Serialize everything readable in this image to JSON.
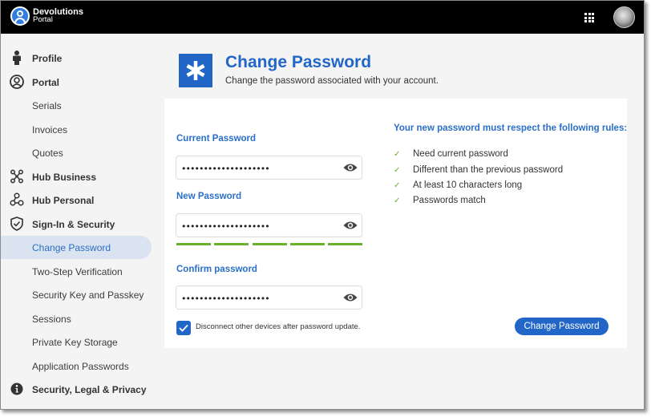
{
  "app": {
    "logo_line1": "Devolutions",
    "logo_line2": "Portal",
    "apps_icon": "grid-icon",
    "avatar": "user-avatar"
  },
  "sidebar": {
    "items": [
      {
        "label": "Profile",
        "icon": "person-icon",
        "top": true
      },
      {
        "label": "Portal",
        "icon": "user-circle-icon",
        "top": true
      },
      {
        "label": "Serials"
      },
      {
        "label": "Invoices"
      },
      {
        "label": "Quotes"
      },
      {
        "label": "Hub Business",
        "icon": "hub-business-icon",
        "top": true
      },
      {
        "label": "Hub Personal",
        "icon": "hub-personal-icon",
        "top": true
      },
      {
        "label": "Sign-In & Security",
        "icon": "shield-check-icon",
        "top": true
      },
      {
        "label": "Change Password",
        "active": true
      },
      {
        "label": "Two-Step Verification"
      },
      {
        "label": "Security Key and Passkey"
      },
      {
        "label": "Sessions"
      },
      {
        "label": "Private Key Storage"
      },
      {
        "label": "Application Passwords"
      },
      {
        "label": "Security, Legal & Privacy",
        "icon": "info-icon",
        "top": true
      }
    ]
  },
  "header": {
    "icon": "asterisk-icon",
    "icon_glyph": "*",
    "title": "Change Password",
    "subtitle": "Change the password associated with your account."
  },
  "form": {
    "current": {
      "label": "Current Password",
      "value": "••••••••••••••••••••"
    },
    "new": {
      "label": "New Password",
      "value": "••••••••••••••••••••",
      "strength_segments_filled": 5,
      "strength_segments_total": 5
    },
    "confirm": {
      "label": "Confirm password",
      "value": "••••••••••••••••••••"
    },
    "disconnect": {
      "label": "Disconnect other devices after password update.",
      "checked": true
    },
    "submit_label": "Change Password"
  },
  "rules": {
    "title": "Your new password must respect the following rules:",
    "items": [
      {
        "text": "Need current password",
        "met": true
      },
      {
        "text": "Different than the previous password",
        "met": true
      },
      {
        "text": "At least 10 characters long",
        "met": true
      },
      {
        "text": "Passwords match",
        "met": true
      }
    ],
    "check_glyph": "✓"
  },
  "colors": {
    "accent": "#2266c8",
    "success": "#6ab02d",
    "active_nav_bg": "#dae4f1"
  }
}
